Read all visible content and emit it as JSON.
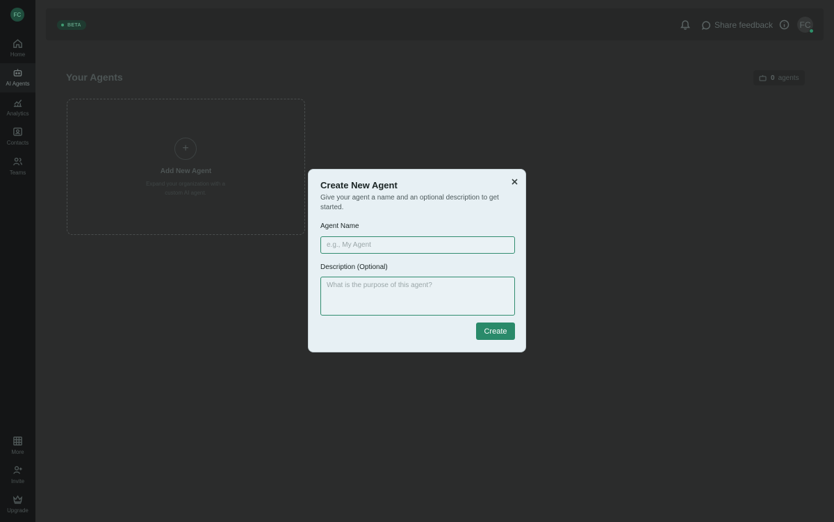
{
  "sidebar": {
    "avatar": "FC",
    "items": [
      {
        "label": "Home",
        "icon": "home-icon"
      },
      {
        "label": "AI Agents",
        "icon": "robot-icon"
      },
      {
        "label": "Analytics",
        "icon": "analytics-icon"
      },
      {
        "label": "Contacts",
        "icon": "contacts-icon"
      },
      {
        "label": "Teams",
        "icon": "teams-icon"
      }
    ],
    "bottom_items": [
      {
        "label": "More",
        "icon": "grid-icon"
      },
      {
        "label": "Invite",
        "icon": "invite-icon"
      },
      {
        "label": "Upgrade",
        "icon": "crown-icon"
      }
    ]
  },
  "topbar": {
    "badge": "BETA",
    "feedback": "Share feedback",
    "user_initials": "FC"
  },
  "page": {
    "title": "Your Agents",
    "agent_count": "0",
    "agent_count_label": "agents"
  },
  "add_card": {
    "icon": "+",
    "title": "Add New Agent",
    "description": "Expand your organization with a custom AI agent."
  },
  "modal": {
    "title": "Create New Agent",
    "subtitle": "Give your agent a name and an optional description to get started.",
    "name_label": "Agent Name",
    "name_placeholder": "e.g., My Agent",
    "description_label": "Description (Optional)",
    "description_placeholder": "What is the purpose of this agent?",
    "create_label": "Create"
  },
  "colors": {
    "accent": "#2a8a6a",
    "sidebar_bg": "#141516",
    "main_bg": "#2b2c2c",
    "modal_bg": "#e7f0f4"
  }
}
